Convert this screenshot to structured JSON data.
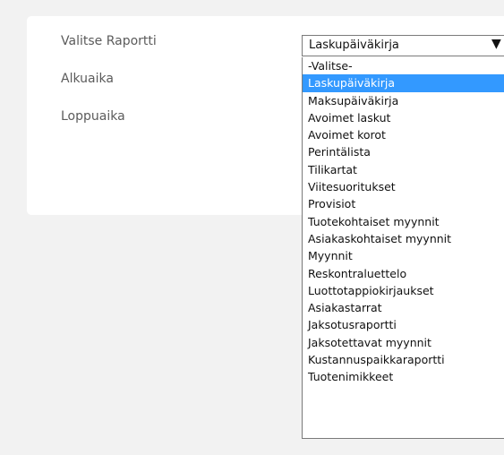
{
  "form": {
    "report_label": "Valitse Raportti",
    "start_label": "Alkuaika",
    "end_label": "Loppuaika"
  },
  "report_select": {
    "selected": "Laskupäiväkirja",
    "options": [
      "-Valitse-",
      "Laskupäiväkirja",
      "Maksupäiväkirja",
      "Avoimet laskut",
      "Avoimet korot",
      "Perintälista",
      "Tilikartat",
      "Viitesuoritukset",
      "Provisiot",
      "Tuotekohtaiset myynnit",
      "Asiakaskohtaiset myynnit",
      "Myynnit",
      "Reskontraluettelo",
      "Luottotappiokirjaukset",
      "Asiakastarrat",
      "Jaksotusraportti",
      "Jaksotettavat myynnit",
      "Kustannuspaikkaraportti",
      "Tuotenimikkeet"
    ],
    "highlighted_index": 1
  },
  "colors": {
    "highlight": "#3399ff",
    "panel_bg": "#ffffff",
    "page_bg": "#f2f2f2"
  },
  "icons": {
    "dropdown_arrow": "caret-down-icon"
  }
}
